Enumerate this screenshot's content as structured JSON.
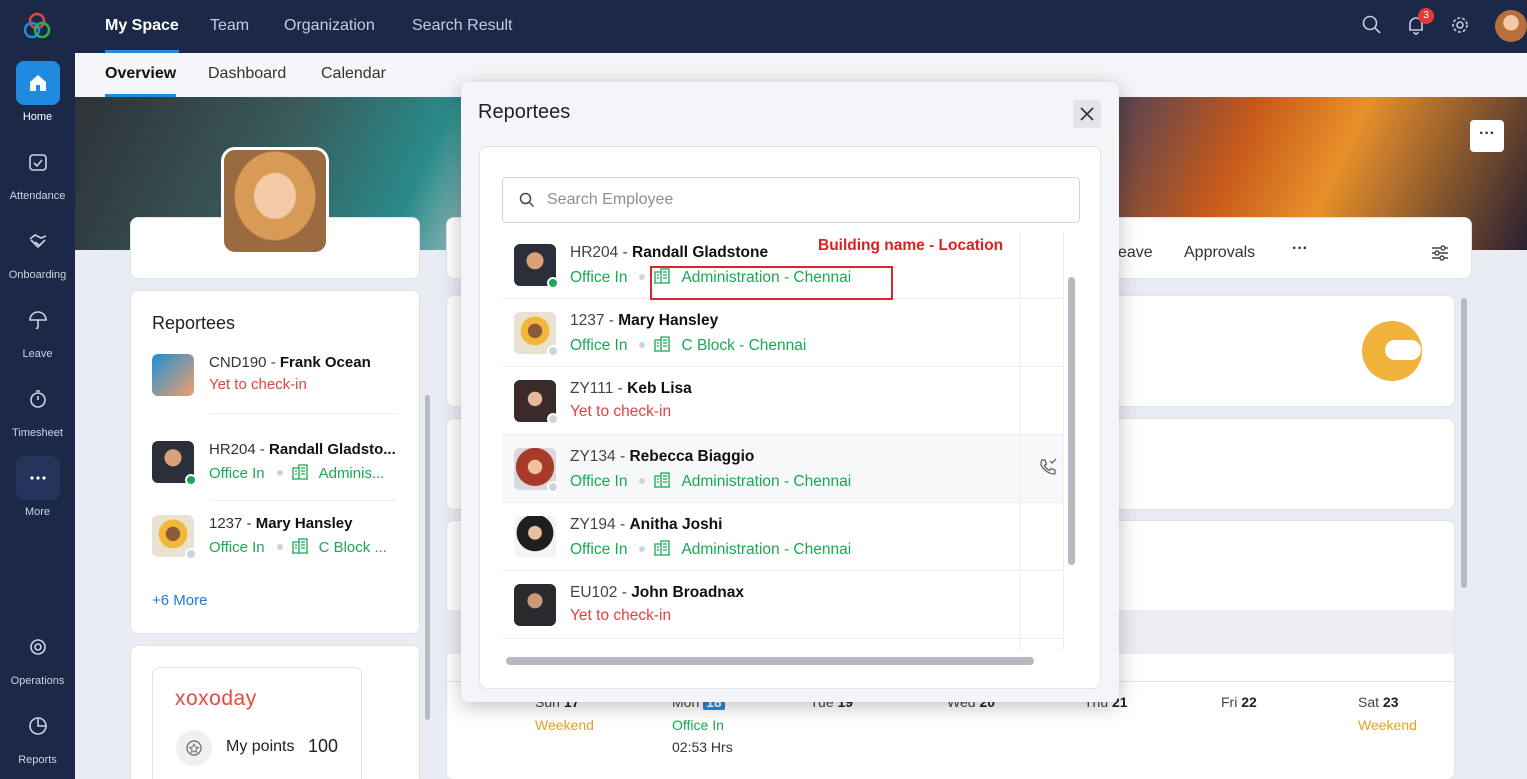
{
  "app": {
    "top_tabs": [
      "My Space",
      "Team",
      "Organization",
      "Search Result"
    ],
    "sub_tabs": [
      "Overview",
      "Dashboard",
      "Calendar"
    ],
    "notification_count": "3",
    "icons": {
      "search": "search-icon",
      "bell": "bell-icon",
      "settings": "gear-icon"
    }
  },
  "sidebar": {
    "items": [
      {
        "label": "Home",
        "icon": "home-icon"
      },
      {
        "label": "Attendance",
        "icon": "calendar-check-icon"
      },
      {
        "label": "Onboarding",
        "icon": "handshake-icon"
      },
      {
        "label": "Leave",
        "icon": "umbrella-icon"
      },
      {
        "label": "Timesheet",
        "icon": "stopwatch-icon"
      },
      {
        "label": "More",
        "icon": "more-icon"
      },
      {
        "label": "Operations",
        "icon": "operations-icon"
      },
      {
        "label": "Reports",
        "icon": "pie-chart-icon"
      }
    ]
  },
  "background": {
    "reportees_title": "Reportees",
    "reportees": [
      {
        "code": "CND190",
        "name": "Frank Ocean",
        "status": "Yet to check-in"
      },
      {
        "code": "HR204",
        "name": "Randall Gladsto...",
        "status": "Office In",
        "location": "Adminis..."
      },
      {
        "code": "1237",
        "name": "Mary Hansley",
        "status": "Office In",
        "location": "C Block ..."
      }
    ],
    "more_link": "+6 More",
    "rewards_brand": "xoxoday",
    "points_label": "My points",
    "points_value": "100",
    "tabs_partial": [
      "eave",
      "Approvals",
      "···"
    ],
    "calendar": [
      {
        "day": "Sun",
        "date": "17",
        "sub": "Weekend"
      },
      {
        "day": "Mon",
        "date": "18",
        "sub": "Office In",
        "sub2": "02:53 Hrs"
      },
      {
        "day": "Tue",
        "date": "19"
      },
      {
        "day": "Wed",
        "date": "20"
      },
      {
        "day": "Thu",
        "date": "21"
      },
      {
        "day": "Fri",
        "date": "22"
      },
      {
        "day": "Sat",
        "date": "23",
        "sub": "Weekend"
      }
    ]
  },
  "modal": {
    "title": "Reportees",
    "search_placeholder": "Search Employee",
    "annotation": "Building name - Location",
    "employees": [
      {
        "code": "HR204",
        "name": "Randall Gladstone",
        "status": "Office In",
        "location": "Administration - Chennai",
        "online": true
      },
      {
        "code": "1237",
        "name": "Mary Hansley",
        "status": "Office In",
        "location": "C Block - Chennai",
        "online": false
      },
      {
        "code": "ZY111",
        "name": "Keb Lisa",
        "status": "Yet to check-in",
        "online": false
      },
      {
        "code": "ZY134",
        "name": "Rebecca Biaggio",
        "status": "Office In",
        "location": "Administration - Chennai",
        "online": false
      },
      {
        "code": "ZY194",
        "name": "Anitha Joshi",
        "status": "Office In",
        "location": "Administration - Chennai",
        "online": false
      },
      {
        "code": "EU102",
        "name": "John Broadnax",
        "status": "Yet to check-in",
        "online": false
      }
    ]
  }
}
